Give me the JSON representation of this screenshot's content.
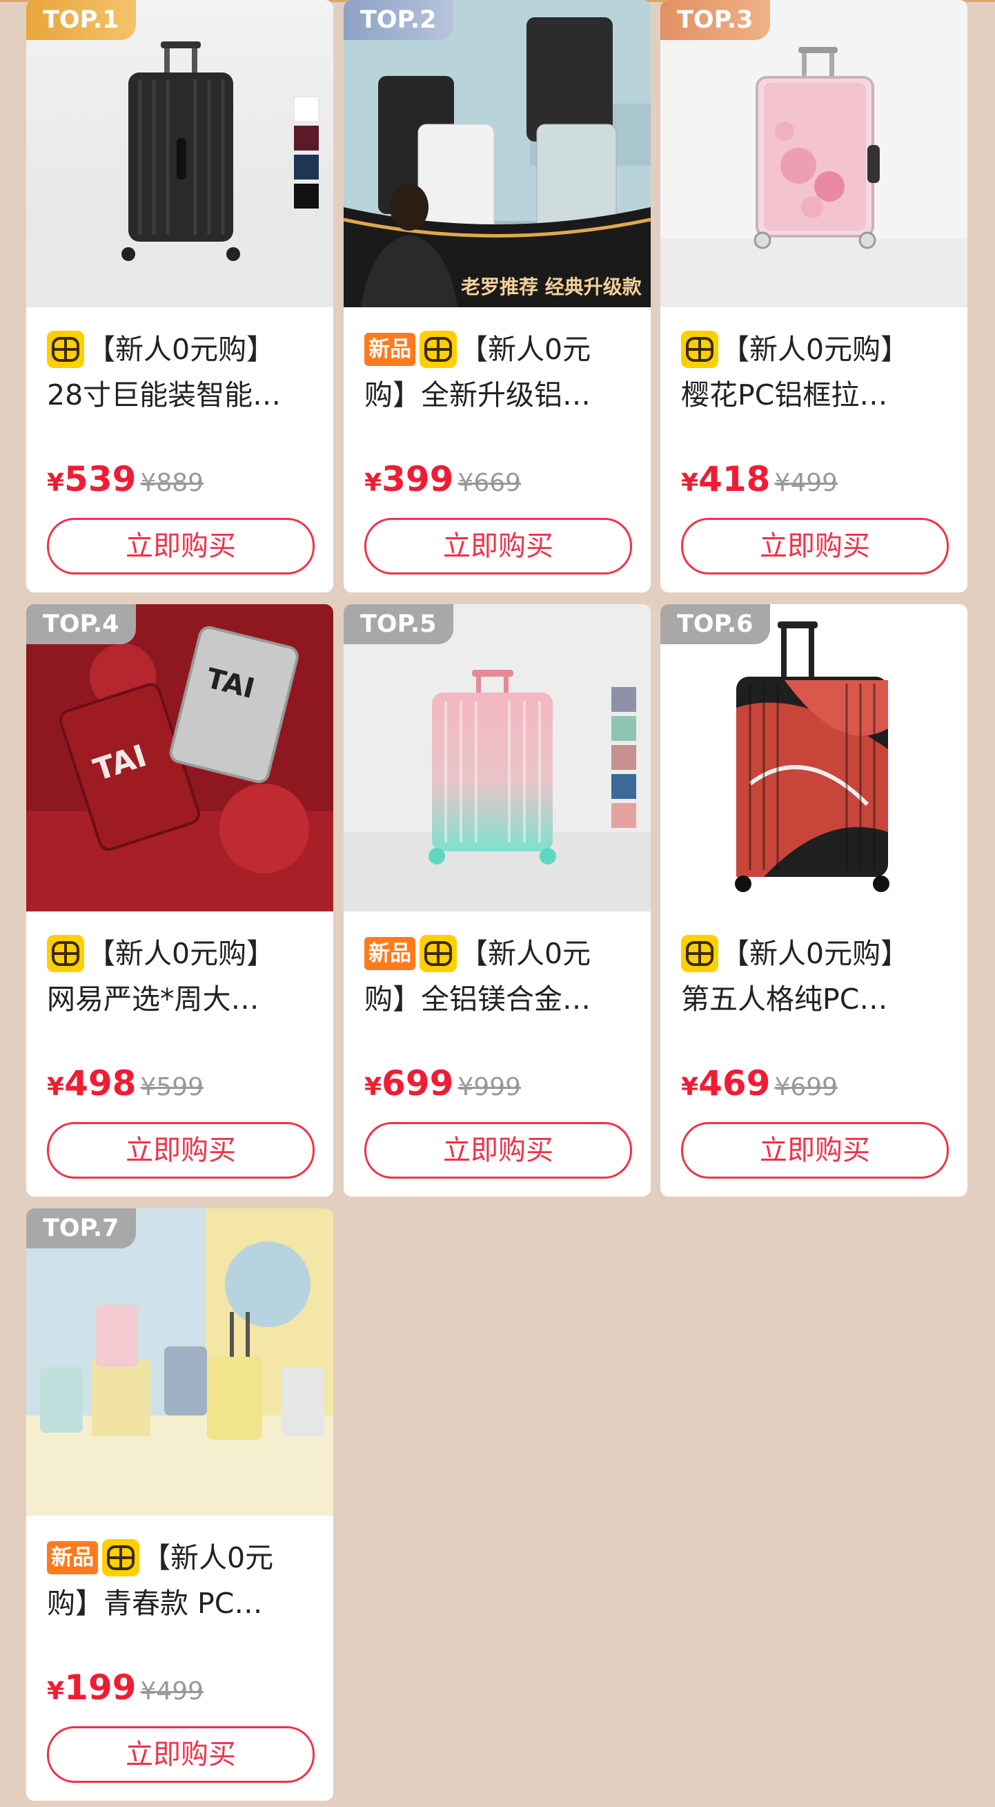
{
  "colors": {
    "page_bg": "#e3cfc0",
    "price_red": "#f01c34",
    "button_red": "#f23047",
    "new_badge": "#ff7a1c",
    "store_badge": "#ffcf00"
  },
  "products": [
    {
      "rank": "TOP.1",
      "badge_new": false,
      "title_line1": "【新人0元购】",
      "title_line2": "28寸巨能装智能…",
      "yen": "¥",
      "price": "539",
      "original": "¥889",
      "buy_label": "立即购买",
      "image": "black-suitcase-with-color-swatches"
    },
    {
      "rank": "TOP.2",
      "badge_new": true,
      "new_label": "新品",
      "title_line1": "【新人0元",
      "title_line2": "购】全新升级铝…",
      "yen": "¥",
      "price": "399",
      "original": "¥669",
      "buy_label": "立即购买",
      "image": "aluminum-suitcases-with-presenter",
      "image_caption": "老罗推荐 经典升级款"
    },
    {
      "rank": "TOP.3",
      "badge_new": false,
      "title_line1": "【新人0元购】",
      "title_line2": "樱花PC铝框拉…",
      "yen": "¥",
      "price": "418",
      "original": "¥499",
      "buy_label": "立即购买",
      "image": "pink-sakura-suitcase"
    },
    {
      "rank": "TOP.4",
      "badge_new": false,
      "title_line1": "【新人0元购】",
      "title_line2": "网易严选*周大…",
      "yen": "¥",
      "price": "498",
      "original": "¥599",
      "buy_label": "立即购买",
      "image": "red-and-silver-graffiti-suitcases"
    },
    {
      "rank": "TOP.5",
      "badge_new": true,
      "new_label": "新品",
      "title_line1": "【新人0元",
      "title_line2": "购】全铝镁合金…",
      "yen": "¥",
      "price": "699",
      "original": "¥999",
      "buy_label": "立即购买",
      "image": "pink-mint-gradient-suitcase"
    },
    {
      "rank": "TOP.6",
      "badge_new": false,
      "title_line1": "【新人0元购】",
      "title_line2": "第五人格纯PC…",
      "yen": "¥",
      "price": "469",
      "original": "¥699",
      "buy_label": "立即购买",
      "image": "black-red-identity-suitcase"
    },
    {
      "rank": "TOP.7",
      "badge_new": true,
      "new_label": "新品",
      "title_line1": "【新人0元",
      "title_line2": "购】青春款 PC…",
      "yen": "¥",
      "price": "199",
      "original": "¥499",
      "buy_label": "立即购买",
      "image": "pastel-youth-suitcases"
    }
  ]
}
